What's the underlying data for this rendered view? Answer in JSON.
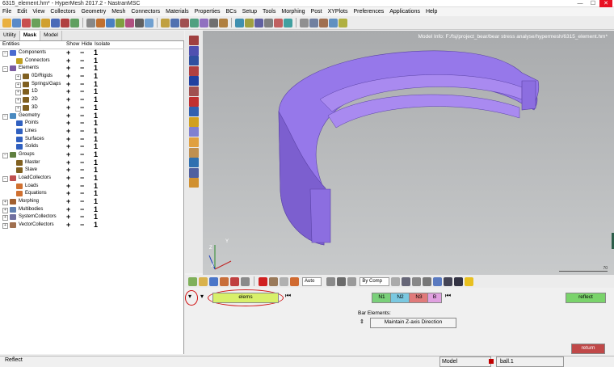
{
  "window": {
    "title": "6315_element.hm* - HyperMesh 2017.2 - NastranMSC"
  },
  "menu": [
    "File",
    "Edit",
    "View",
    "Collectors",
    "Geometry",
    "Mesh",
    "Connectors",
    "Materials",
    "Properties",
    "BCs",
    "Setup",
    "Tools",
    "Morphing",
    "Post",
    "XYPlots",
    "Preferences",
    "Applications",
    "Help"
  ],
  "tabs": [
    "Utility",
    "Mask",
    "Model"
  ],
  "tree_header": {
    "entities": "Entities",
    "show": "Show",
    "hide": "Hide",
    "isolate": "Isolate"
  },
  "tree": [
    {
      "label": "Components",
      "level": 0
    },
    {
      "label": "Connectors",
      "level": 1
    },
    {
      "label": "Elements",
      "level": 0
    },
    {
      "label": "0D/Rigids",
      "level": 2
    },
    {
      "label": "Springs/Gaps",
      "level": 2
    },
    {
      "label": "1D",
      "level": 2
    },
    {
      "label": "2D",
      "level": 2
    },
    {
      "label": "3D",
      "level": 2
    },
    {
      "label": "Geometry",
      "level": 0
    },
    {
      "label": "Points",
      "level": 1
    },
    {
      "label": "Lines",
      "level": 1
    },
    {
      "label": "Surfaces",
      "level": 1
    },
    {
      "label": "Solids",
      "level": 1
    },
    {
      "label": "Groups",
      "level": 0
    },
    {
      "label": "Master",
      "level": 1
    },
    {
      "label": "Slave",
      "level": 1
    },
    {
      "label": "LoadCollectors",
      "level": 0
    },
    {
      "label": "Loads",
      "level": 1
    },
    {
      "label": "Equations",
      "level": 1
    },
    {
      "label": "Morphing",
      "level": 0
    },
    {
      "label": "Multibodies",
      "level": 0
    },
    {
      "label": "SystemCollectors",
      "level": 0
    },
    {
      "label": "VectorCollectors",
      "level": 0
    }
  ],
  "tree_controls": {
    "show": "+",
    "hide": "−",
    "isolate": "1"
  },
  "viewport": {
    "model_info": "Model Info: F:/fsj/project_bear/bear stress analyse/hypermesh/6315_element.hm*",
    "scale": "70"
  },
  "toolbar2": {
    "auto": "Auto",
    "bycomp": "By Comp"
  },
  "panel": {
    "elems": "elems",
    "n1": "N1",
    "n2": "N2",
    "n3": "N3",
    "b": "B",
    "reflect": "reflect",
    "bar_elements": "Bar Elements:",
    "maintain": "Maintain Z-axis Direction",
    "return": "return"
  },
  "status": {
    "left": "Reflect",
    "model": "Model",
    "comp": "ball.1"
  },
  "colors": {
    "model": "#8a6be0",
    "elems_field": "#d8f06a",
    "reflect_btn": "#7ad36b"
  }
}
